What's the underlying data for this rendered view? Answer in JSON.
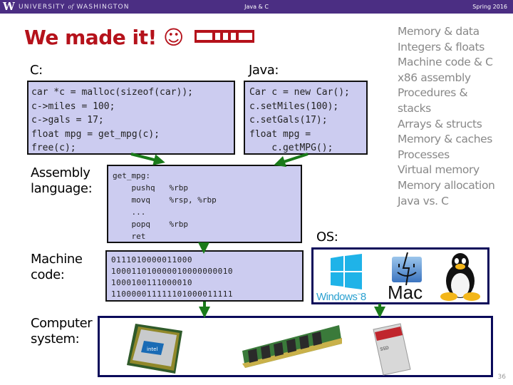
{
  "header": {
    "logo": "W",
    "university_pre": "UNIVERSITY",
    "university_of": "of",
    "university_post": "WASHINGTON",
    "lecture": "Java & C",
    "term": "Spring 2016"
  },
  "title": "We made it! ☺",
  "labels": {
    "c": "C:",
    "java": "Java:",
    "assembly": [
      "Assembly",
      "language:"
    ],
    "machine": [
      "Machine",
      "code:"
    ],
    "os": "OS:",
    "computer": [
      "Computer",
      "system:"
    ]
  },
  "c_code": [
    "car *c = malloc(sizeof(car));",
    "c->miles = 100;",
    "c->gals = 17;",
    "float mpg = get_mpg(c);",
    "free(c);"
  ],
  "java_code": [
    "Car c = new Car();",
    "c.setMiles(100);",
    "c.setGals(17);",
    "float mpg =",
    "    c.getMPG();"
  ],
  "assembly_code": [
    "get_mpg:",
    "    pushq   %rbp",
    "    movq    %rsp, %rbp",
    "    ...",
    "    popq    %rbp",
    "    ret"
  ],
  "machine_code": [
    "0111010000011000",
    "100011010000010000000010",
    "1000100111000010",
    "110000011111101000011111"
  ],
  "topics": [
    "Memory & data",
    "Integers & floats",
    "Machine code & C",
    "x86 assembly",
    "Procedures &",
    "stacks",
    "Arrays & structs",
    "Memory & caches",
    "Processes",
    "Virtual memory",
    "Memory allocation",
    "Java vs. C"
  ],
  "os_logos": {
    "windows": "Windows",
    "windows_version": "8",
    "mac": "Mac"
  },
  "hardware": [
    "cpu",
    "ram",
    "ssd"
  ],
  "page_number": "36",
  "colors": {
    "header_bg": "#4b2e83",
    "title": "#b5121b",
    "code_bg": "#ccccf0",
    "arrow": "#1a7a1a",
    "frame": "#0a0a5a",
    "topics": "#888888"
  }
}
